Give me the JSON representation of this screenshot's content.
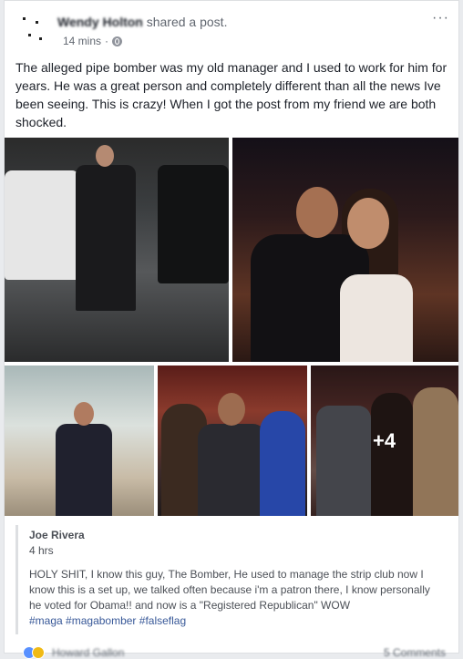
{
  "post": {
    "author_name": "Wendy Holton",
    "action_text": "shared a post.",
    "timestamp": "14 mins",
    "more_icon": "···",
    "body": "The alleged pipe bomber was my old manager and I used to work for him for years. He was a great person and completely different than all the news Ive been seeing. This is crazy! When I got the post from my friend we are both shocked.",
    "photos_more_count": "+4"
  },
  "shared": {
    "author": "Joe Rivera",
    "time": "4 hrs",
    "text": "HOLY SHIT, I know this guy, The Bomber, He used to manage the strip club now I know this is a set up, we talked often because i'm a patron there, I know personally he voted for Obama!! and now is a \"Registered Republican\" WOW",
    "hashtags": [
      "#maga",
      "#magabomber",
      "#falseflag"
    ]
  },
  "footer": {
    "names": "Howard Gallon",
    "comments": "5 Comments"
  }
}
